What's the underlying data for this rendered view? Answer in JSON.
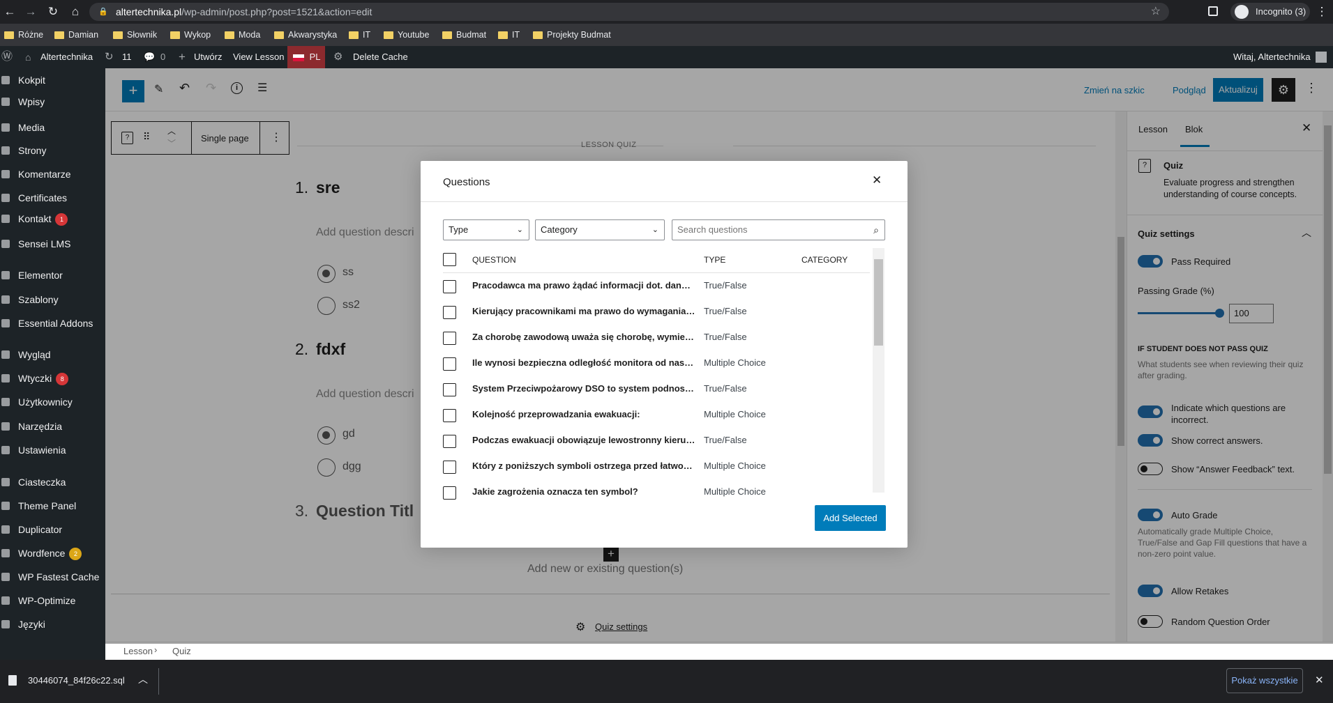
{
  "browser": {
    "url_host": "altertechnika.pl",
    "url_path": "/wp-admin/post.php?post=1521&action=edit",
    "incognito_label": "Incognito (3)",
    "bookmarks": [
      "Różne",
      "Damian",
      "Słownik",
      "Wykop",
      "Moda",
      "Akwarystyka",
      "IT",
      "Youtube",
      "Budmat",
      "IT",
      "Projekty Budmat"
    ]
  },
  "adminbar": {
    "site": "Altertechnika",
    "updates": "11",
    "comments": "0",
    "new": "Utwórz",
    "view": "View Lesson",
    "lang": "PL",
    "cache": "Delete Cache",
    "greeting": "Witaj, Altertechnika"
  },
  "sidebar": {
    "items": [
      {
        "label": "Kokpit"
      },
      {
        "label": "Wpisy"
      },
      {
        "label": "Media"
      },
      {
        "label": "Strony"
      },
      {
        "label": "Komentarze"
      },
      {
        "label": "Certificates"
      },
      {
        "label": "Kontakt",
        "badge": "1"
      },
      {
        "label": "Sensei LMS"
      },
      {
        "label": "Elementor"
      },
      {
        "label": "Szablony"
      },
      {
        "label": "Essential Addons"
      },
      {
        "label": "Wygląd"
      },
      {
        "label": "Wtyczki",
        "badge": "8"
      },
      {
        "label": "Użytkownicy"
      },
      {
        "label": "Narzędzia"
      },
      {
        "label": "Ustawienia"
      },
      {
        "label": "Ciasteczka"
      },
      {
        "label": "Theme Panel"
      },
      {
        "label": "Duplicator"
      },
      {
        "label": "Wordfence",
        "badge": "2"
      },
      {
        "label": "WP Fastest Cache"
      },
      {
        "label": "WP-Optimize"
      },
      {
        "label": "Języki"
      }
    ]
  },
  "toolbar": {
    "draft": "Zmień na szkic",
    "preview": "Podgląd",
    "update": "Aktualizuj"
  },
  "blocktoolbar": {
    "mode": "Single page"
  },
  "canvas": {
    "section_label": "LESSON QUIZ",
    "q1": {
      "num": "1.",
      "title": "sre",
      "desc": "Add question descri",
      "answers": [
        "ss",
        "ss2"
      ]
    },
    "q2": {
      "num": "2.",
      "title": "fdxf",
      "desc": "Add question descri",
      "answers": [
        "gd",
        "dgg"
      ]
    },
    "q3": {
      "num": "3.",
      "title": "Question Titl"
    },
    "add_new": "Add new or existing question(s)",
    "quiz_settings": "Quiz settings"
  },
  "breadcrumb": [
    "Lesson",
    "Quiz"
  ],
  "modal": {
    "title": "Questions",
    "type_filter": "Type",
    "category_filter": "Category",
    "search_placeholder": "Search questions",
    "columns": {
      "question": "QUESTION",
      "type": "TYPE",
      "category": "CATEGORY"
    },
    "rows": [
      {
        "title": "Pracodawca ma prawo żądać informacji dot. danych osobowych",
        "type": "True/False"
      },
      {
        "title": "Kierujący pracownikami ma prawo do wymagania od pracowników",
        "type": "True/False"
      },
      {
        "title": "Za chorobę zawodową uważa się chorobę, wymienioną w wykazie",
        "type": "True/False"
      },
      {
        "title": "Ile wynosi bezpieczna odległość monitora od naszych oczu",
        "type": "Multiple Choice"
      },
      {
        "title": "System Przeciwpożarowy DSO to system podnoszący alarm",
        "type": "True/False"
      },
      {
        "title": "Kolejność przeprowadzania ewakuacji:",
        "type": "Multiple Choice"
      },
      {
        "title": "Podczas ewakuacji obowiązuje lewostronny kierunek ruchu",
        "type": "True/False"
      },
      {
        "title": "Który z poniższych symboli ostrzega przed łatwopalnymi materiałami",
        "type": "Multiple Choice"
      },
      {
        "title": "Jakie zagrożenia oznacza ten symbol?",
        "type": "Multiple Choice"
      }
    ],
    "add_button": "Add Selected"
  },
  "panel": {
    "tabs": [
      "Lesson",
      "Blok"
    ],
    "block_name": "Quiz",
    "block_desc": "Evaluate progress and strengthen understanding of course concepts.",
    "settings_title": "Quiz settings",
    "pass_required": "Pass Required",
    "passing_grade_label": "Passing Grade (%)",
    "passing_grade": "100",
    "fail_heading": "IF STUDENT DOES NOT PASS QUIZ",
    "fail_help": "What students see when reviewing their quiz after grading.",
    "indicate": "Indicate which questions are incorrect.",
    "show_correct": "Show correct answers.",
    "show_feedback": "Show “Answer Feedback” text.",
    "auto_grade": "Auto Grade",
    "auto_grade_help": "Automatically grade Multiple Choice, True/False and Gap Fill questions that have a non-zero point value.",
    "retakes": "Allow Retakes",
    "random": "Random Question Order"
  },
  "downloads": {
    "file": "30446074_84f26c22.sql",
    "show_all": "Pokaż wszystkie"
  }
}
